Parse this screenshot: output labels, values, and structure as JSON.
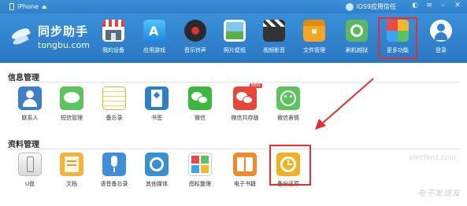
{
  "titlebar": {
    "device": "iPhone",
    "trust": "iOS9应用信任"
  },
  "logo": {
    "name": "同步助手",
    "domain": "tongbu.com"
  },
  "toolbar": {
    "items": [
      {
        "label": "我的设备",
        "icon": "store-icon"
      },
      {
        "label": "应用游戏",
        "icon": "app-store-icon"
      },
      {
        "label": "音乐铃声",
        "icon": "music-disc-icon"
      },
      {
        "label": "照片壁纸",
        "icon": "photo-icon"
      },
      {
        "label": "视频影音",
        "icon": "clapper-icon"
      },
      {
        "label": "文件管理",
        "icon": "folder-icon"
      },
      {
        "label": "刷机越狱",
        "icon": "flash-icon"
      },
      {
        "label": "更多功能",
        "icon": "more-icon"
      },
      {
        "label": "登录",
        "icon": "user-icon"
      }
    ]
  },
  "sections": {
    "info": {
      "title": "信息管理",
      "items": [
        {
          "label": "联系人",
          "icon": "contacts-icon"
        },
        {
          "label": "短信管理",
          "icon": "message-icon"
        },
        {
          "label": "备忘录",
          "icon": "notes-icon"
        },
        {
          "label": "书签",
          "icon": "bookmark-icon"
        },
        {
          "label": "微信",
          "icon": "wechat-icon"
        },
        {
          "label": "微信共存版",
          "icon": "wechat-dual-icon",
          "badge": "NEW"
        },
        {
          "label": "微信表情",
          "icon": "wechat-emoji-icon"
        }
      ]
    },
    "data": {
      "title": "资料管理",
      "items": [
        {
          "label": "U盘",
          "icon": "usb-drive-icon"
        },
        {
          "label": "文档",
          "icon": "document-icon"
        },
        {
          "label": "语音备忘录",
          "icon": "microphone-icon"
        },
        {
          "label": "其他媒体",
          "icon": "media-icon"
        },
        {
          "label": "图标整理",
          "icon": "icon-organize-icon"
        },
        {
          "label": "电子书籍",
          "icon": "ebook-icon"
        },
        {
          "label": "备份还原",
          "icon": "backup-restore-icon"
        }
      ]
    }
  },
  "watermark": {
    "site": "elecfans.com",
    "text": "电子发烧友"
  },
  "colors": {
    "toolbar": "#2f82cf",
    "highlight": "#e03030"
  }
}
